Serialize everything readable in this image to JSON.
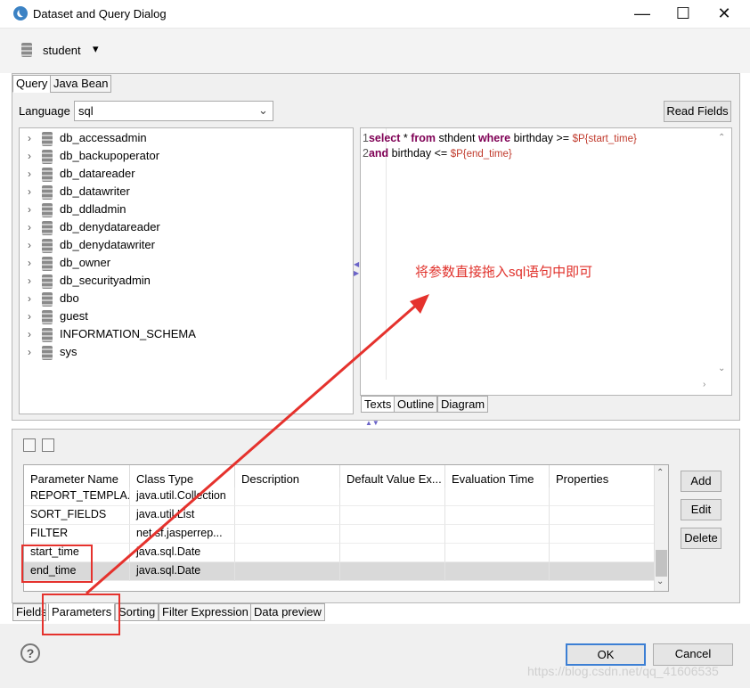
{
  "window": {
    "title": "Dataset and Query Dialog",
    "minimize": "—",
    "maximize": "☐",
    "close": "✕"
  },
  "dataset": {
    "name": "student",
    "dropdown": "▾"
  },
  "top_tabs": [
    {
      "label": "Query",
      "active": true
    },
    {
      "label": "Java Bean",
      "active": false
    }
  ],
  "language": {
    "label": "Language",
    "value": "sql"
  },
  "read_fields_label": "Read Fields",
  "schemas": [
    "db_accessadmin",
    "db_backupoperator",
    "db_datareader",
    "db_datawriter",
    "db_ddladmin",
    "db_denydatareader",
    "db_denydatawriter",
    "db_owner",
    "db_securityadmin",
    "dbo",
    "guest",
    "INFORMATION_SCHEMA",
    "sys"
  ],
  "sql": {
    "line1": {
      "num": "1",
      "k1": "select",
      "t1": " * ",
      "k2": "from",
      "t2": " sthdent ",
      "k3": "where",
      "t3": " birthday >= ",
      "p": "$P{start_time}"
    },
    "line2": {
      "num": "2",
      "k1": "and",
      "t1": " birthday <= ",
      "p": "$P{end_time}"
    }
  },
  "editor_tabs": [
    "Texts",
    "Outline",
    "Diagram"
  ],
  "annotation": "将参数直接拖入sql语句中即可",
  "params_table": {
    "columns": [
      "Parameter Name",
      "Class Type",
      "Description",
      "Default Value Ex...",
      "Evaluation Time",
      "Properties"
    ],
    "rows": [
      [
        "REPORT_TEMPLA...",
        "java.util.Collection",
        "",
        "",
        "",
        ""
      ],
      [
        "SORT_FIELDS",
        "java.util.List",
        "",
        "",
        "",
        ""
      ],
      [
        "FILTER",
        "net.sf.jasperrep...",
        "",
        "",
        "",
        ""
      ],
      [
        "start_time",
        "java.sql.Date",
        "",
        "",
        "",
        ""
      ],
      [
        "end_time",
        "java.sql.Date",
        "",
        "",
        "",
        ""
      ]
    ]
  },
  "side_buttons": {
    "add": "Add",
    "edit": "Edit",
    "delete": "Delete"
  },
  "bottom_tabs": [
    "Fields",
    "Parameters",
    "Sorting",
    "Filter Expression",
    "Data preview"
  ],
  "footer": {
    "help": "?",
    "ok": "OK",
    "cancel": "Cancel",
    "watermark": "https://blog.csdn.net/qq_41606535"
  }
}
